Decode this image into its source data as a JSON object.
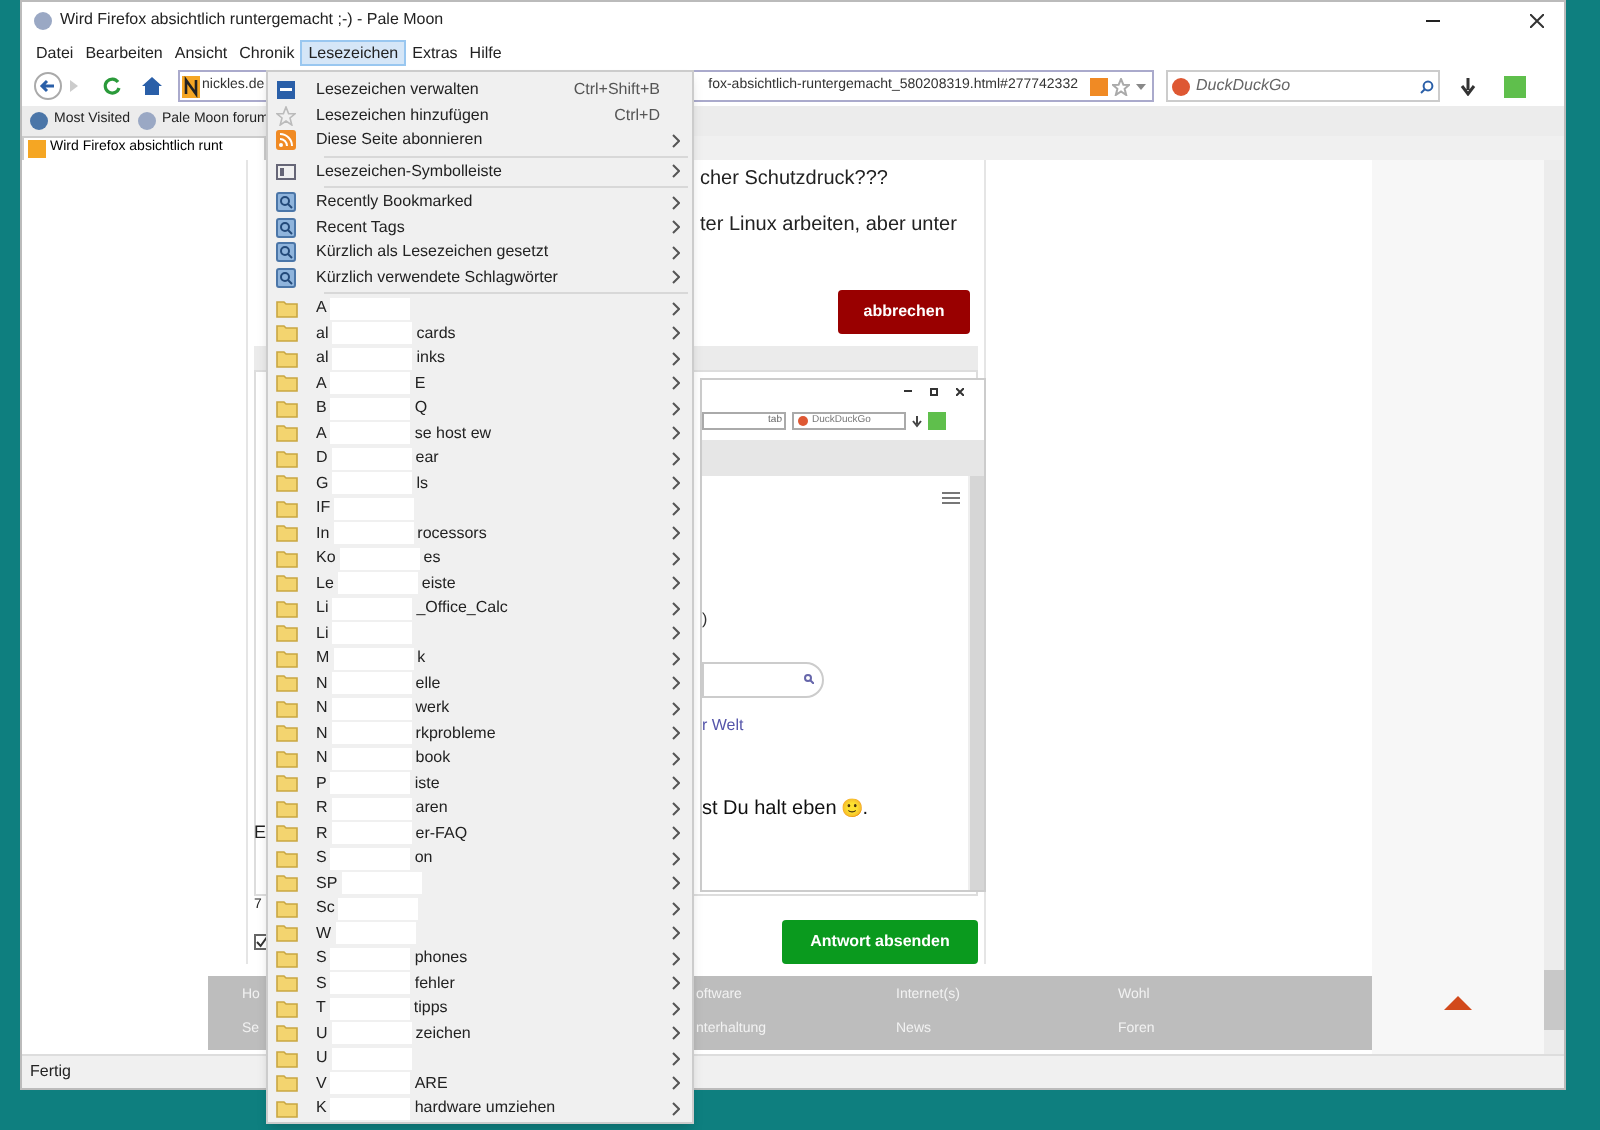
{
  "window": {
    "title": "Wird Firefox absichtlich runtergemacht ;-) - Pale Moon"
  },
  "menu_bar": [
    {
      "label": "Datei",
      "selected": false
    },
    {
      "label": "Bearbeiten",
      "selected": false
    },
    {
      "label": "Ansicht",
      "selected": false
    },
    {
      "label": "Chronik",
      "selected": false
    },
    {
      "label": "Lesezeichen",
      "selected": true
    },
    {
      "label": "Extras",
      "selected": false
    },
    {
      "label": "Hilfe",
      "selected": false
    }
  ],
  "navigation": {
    "site": "nickles.de",
    "address_tail": "fox-absichtlich-runtergemacht_580208319.html#277742332",
    "search_placeholder": "DuckDuckGo"
  },
  "bookmarks_bar": [
    "Most Visited",
    "Pale Moon forum"
  ],
  "tab": {
    "title": "Wird Firefox absichtlich runt"
  },
  "bookmarks_menu": [
    {
      "kind": "library",
      "label": "Lesezeichen verwalten",
      "shortcut": "Ctrl+Shift+B"
    },
    {
      "kind": "star",
      "label": "Lesezeichen hinzufügen",
      "shortcut": "Ctrl+D"
    },
    {
      "kind": "rss",
      "label": "Diese Seite abonnieren",
      "submenu": true
    },
    {
      "kind": "separator"
    },
    {
      "kind": "toolbar",
      "label": "Lesezeichen-Symbolleiste",
      "submenu": true
    },
    {
      "kind": "separator"
    },
    {
      "kind": "query",
      "label": "Recently Bookmarked",
      "submenu": true
    },
    {
      "kind": "query",
      "label": "Recent Tags",
      "submenu": true
    },
    {
      "kind": "query",
      "label": "Kürzlich als Lesezeichen gesetzt",
      "submenu": true
    },
    {
      "kind": "query",
      "label": "Kürzlich verwendete Schlagwörter",
      "submenu": true
    },
    {
      "kind": "separator"
    },
    {
      "kind": "folder",
      "label": "A",
      "submenu": true
    },
    {
      "kind": "folder",
      "label": "al",
      "label_end": "cards",
      "submenu": true
    },
    {
      "kind": "folder",
      "label": "al",
      "label_end": "inks",
      "submenu": true
    },
    {
      "kind": "folder",
      "label": "A",
      "label_end": "E",
      "submenu": true
    },
    {
      "kind": "folder",
      "label": "B",
      "label_end": "Q",
      "submenu": true
    },
    {
      "kind": "folder",
      "label": "A",
      "label_end": "se host ew",
      "submenu": true
    },
    {
      "kind": "folder",
      "label": "D",
      "label_end": "ear",
      "submenu": true
    },
    {
      "kind": "folder",
      "label": "G",
      "label_end": "ls",
      "submenu": true
    },
    {
      "kind": "folder",
      "label": "IF",
      "submenu": true
    },
    {
      "kind": "folder",
      "label": "In",
      "label_end": "rocessors",
      "submenu": true
    },
    {
      "kind": "folder",
      "label": "Ko",
      "label_end": "es",
      "submenu": true
    },
    {
      "kind": "folder",
      "label": "Le",
      "label_end": "eiste",
      "submenu": true
    },
    {
      "kind": "folder",
      "label": "Li",
      "label_end": "_Office_Calc",
      "submenu": true
    },
    {
      "kind": "folder",
      "label": "Li",
      "submenu": true
    },
    {
      "kind": "folder",
      "label": "M",
      "label_end": "k",
      "submenu": true
    },
    {
      "kind": "folder",
      "label": "N",
      "label_end": "elle",
      "submenu": true
    },
    {
      "kind": "folder",
      "label": "N",
      "label_end": "werk",
      "submenu": true
    },
    {
      "kind": "folder",
      "label": "N",
      "label_end": "rkprobleme",
      "submenu": true
    },
    {
      "kind": "folder",
      "label": "N",
      "label_end": "book",
      "submenu": true
    },
    {
      "kind": "folder",
      "label": "P",
      "label_end": "iste",
      "submenu": true
    },
    {
      "kind": "folder",
      "label": "R",
      "label_end": "aren",
      "submenu": true
    },
    {
      "kind": "folder",
      "label": "R",
      "label_end": "er-FAQ",
      "submenu": true
    },
    {
      "kind": "folder",
      "label": "S",
      "label_end": "on",
      "submenu": true
    },
    {
      "kind": "folder",
      "label": "SP",
      "submenu": true
    },
    {
      "kind": "folder",
      "label": "Sc",
      "submenu": true
    },
    {
      "kind": "folder",
      "label": "W",
      "submenu": true
    },
    {
      "kind": "folder",
      "label": "S",
      "label_end": "phones",
      "submenu": true
    },
    {
      "kind": "folder",
      "label": "S",
      "label_end": "fehler",
      "submenu": true
    },
    {
      "kind": "folder",
      "label": "T",
      "label_end": "tipps",
      "submenu": true
    },
    {
      "kind": "folder",
      "label": "U",
      "label_end": "zeichen",
      "submenu": true
    },
    {
      "kind": "folder",
      "label": "U",
      "submenu": true
    },
    {
      "kind": "folder",
      "label": "V",
      "label_end": "ARE",
      "submenu": true
    },
    {
      "kind": "folder",
      "label": "K",
      "label_end": "hardware umziehen",
      "submenu": true
    }
  ],
  "post": {
    "heading": "cher Schutzdruck???",
    "line": "ter Linux arbeiten, aber unter",
    "cancel_button": "abbrechen",
    "left_fragment": "E",
    "counter_fragment": "7",
    "checked": true,
    "submit_button": "Antwort absenden"
  },
  "embedded_screenshot": {
    "address_tail": "tab",
    "search_placeholder": "DuckDuckGo",
    "fragment": ")",
    "link": "r Welt",
    "text": "st Du halt eben",
    "emoji": "🙂",
    "text_end": "."
  },
  "footer": {
    "columns": [
      [
        "Ho",
        "Se"
      ],
      [
        "oftware",
        "nterhaltung"
      ],
      [
        "Internet(s)",
        "News"
      ],
      [
        "Wohl",
        "Foren"
      ]
    ]
  },
  "status_bar": "Fertig"
}
